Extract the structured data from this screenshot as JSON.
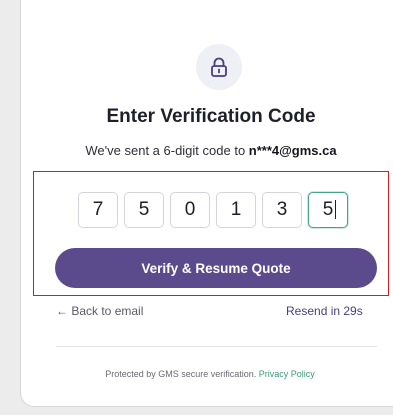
{
  "header": {
    "title": "Enter Verification Code",
    "subtitle_prefix": "We've sent a 6-digit code to ",
    "subtitle_email": "n***4@gms.ca"
  },
  "code": {
    "digits": [
      "7",
      "5",
      "0",
      "1",
      "3",
      "5"
    ],
    "active_index": 5
  },
  "actions": {
    "verify_label": "Verify & Resume Quote",
    "back_label": "← Back to email",
    "resend_label": "Resend in 29s"
  },
  "footer": {
    "text": "Protected by GMS secure verification. ",
    "policy_label": "Privacy Policy"
  },
  "icons": {
    "lock": "lock-icon"
  },
  "colors": {
    "primary_button": "#5c4b8c",
    "active_digit_border": "#46a583",
    "highlight_border": "#cc1f2a",
    "policy_link": "#3d9a78"
  }
}
